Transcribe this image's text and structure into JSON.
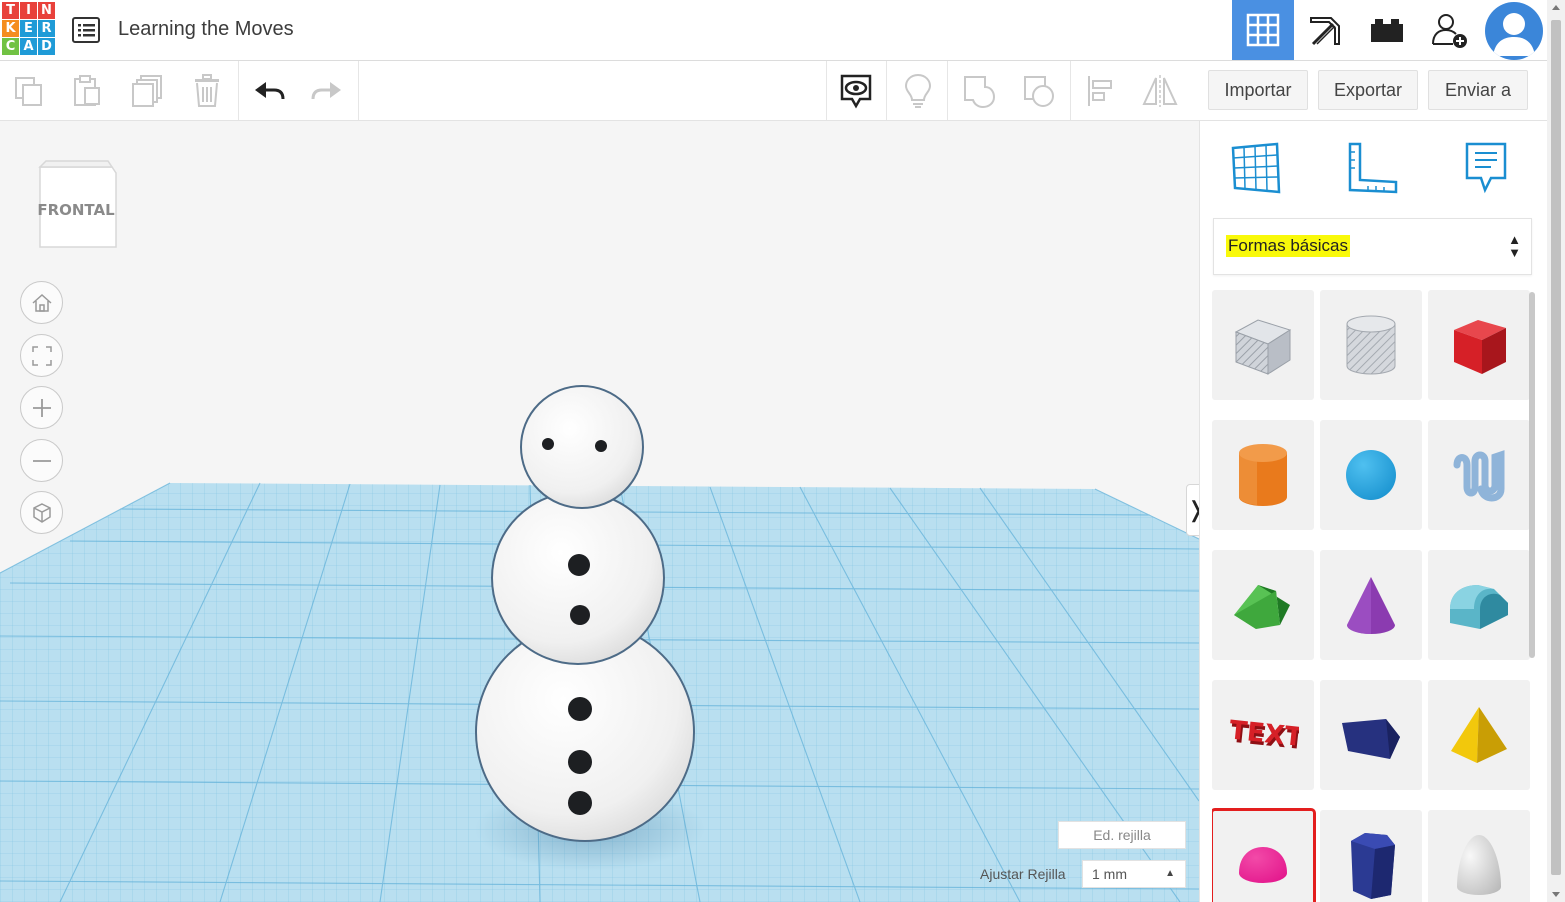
{
  "app": {
    "logo_letters": [
      "T",
      "I",
      "N",
      "K",
      "E",
      "R",
      "C",
      "A",
      "D"
    ],
    "logo_colors": [
      "#e8413b",
      "#e8413b",
      "#e8413b",
      "#f58d1e",
      "#1f9bd7",
      "#1f9bd7",
      "#71c243",
      "#1f9bd7",
      "#1f9bd7"
    ],
    "title": "Learning the Moves",
    "accent": "#4a90e2"
  },
  "topnav": {
    "icons": [
      "3d-grid-icon",
      "pickaxe-icon",
      "bricks-icon",
      "add-user-icon",
      "avatar-icon"
    ]
  },
  "toolbar": {
    "import_label": "Importar",
    "export_label": "Exportar",
    "send_label": "Enviar a",
    "icons": [
      "copy-icon",
      "paste-icon",
      "duplicate-icon",
      "trash-icon",
      "undo-icon",
      "redo-icon",
      "notes-visibility-icon",
      "lightbulb-icon",
      "group-icon",
      "ungroup-icon",
      "align-icon",
      "mirror-icon"
    ]
  },
  "viewport": {
    "view_cube_label": "FRONTAL",
    "edit_grid_label": "Ed. rejilla",
    "snap_label": "Ajustar Rejilla",
    "snap_value": "1 mm",
    "nav_icons": [
      "home-icon",
      "fit-icon",
      "zoom-in-icon",
      "zoom-out-icon",
      "perspective-icon"
    ],
    "collapse_glyph": "❭"
  },
  "panel": {
    "tab_icons": [
      "workplane-icon",
      "ruler-icon",
      "notes-icon"
    ],
    "category": "Formas básicas",
    "shapes": [
      {
        "name": "box-hole",
        "color": "#b9bec6"
      },
      {
        "name": "cylinder-hole",
        "color": "#c7cbd1"
      },
      {
        "name": "box",
        "color": "#d62027"
      },
      {
        "name": "cylinder",
        "color": "#e97a1c"
      },
      {
        "name": "sphere",
        "color": "#1a93d0"
      },
      {
        "name": "scribble",
        "color": "#8fb4d9"
      },
      {
        "name": "roof",
        "color": "#3fa83d"
      },
      {
        "name": "cone",
        "color": "#8b3bb0"
      },
      {
        "name": "round-roof",
        "color": "#5ab5c8"
      },
      {
        "name": "text",
        "color": "#d62027"
      },
      {
        "name": "wedge",
        "color": "#26317f"
      },
      {
        "name": "pyramid",
        "color": "#f2c80c"
      },
      {
        "name": "half-sphere",
        "color": "#e3168c",
        "highlighted": true
      },
      {
        "name": "polygon",
        "color": "#2b3a93"
      },
      {
        "name": "paraboloid",
        "color": "#d6d6d6"
      }
    ]
  }
}
